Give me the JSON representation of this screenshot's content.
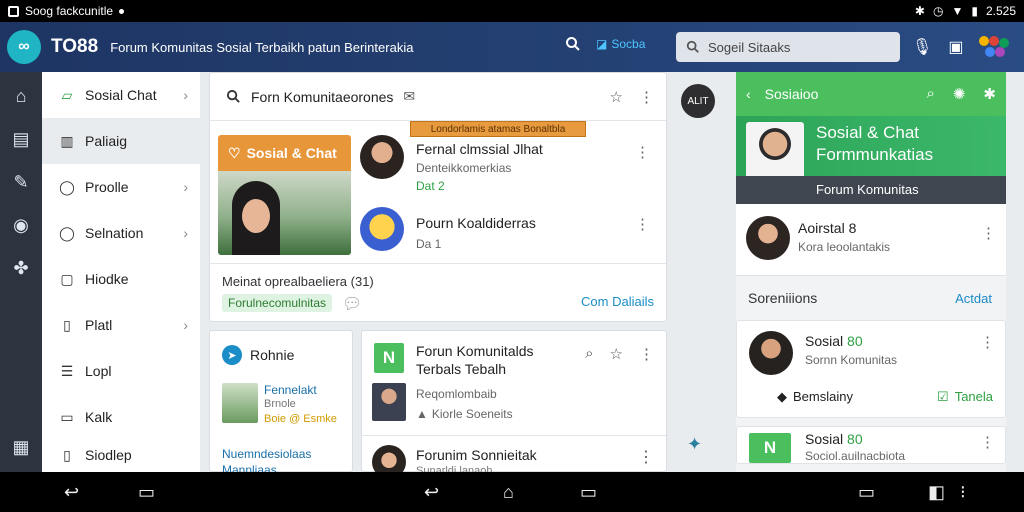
{
  "status": {
    "app_label": "Soog fackcunitle",
    "time": "2.525"
  },
  "appbar": {
    "logo_mark": "∞",
    "brand": "TO88",
    "tagline": "Forum Komunitas Sosial Terbaikh patun Berinterakia",
    "link": "Socba",
    "search_placeholder": "Sogeil Sitaaks"
  },
  "sidebar": {
    "items": [
      {
        "label": "Sosial Chat",
        "icon": "chat-icon",
        "chevron": true
      },
      {
        "label": "Paliaig",
        "icon": "book-icon",
        "chevron": false
      },
      {
        "label": "Proolle",
        "icon": "comment-icon",
        "chevron": true
      },
      {
        "label": "Selnation",
        "icon": "bubble-icon",
        "chevron": true
      },
      {
        "label": "Hiodke",
        "icon": "square-icon",
        "chevron": false
      },
      {
        "label": "Platl",
        "icon": "page-icon",
        "chevron": true
      },
      {
        "label": "Lopl",
        "icon": "list-icon",
        "chevron": false
      },
      {
        "label": "Kalk",
        "icon": "doc-icon",
        "chevron": false
      },
      {
        "label": "Siodlep",
        "icon": "file-icon",
        "chevron": false
      }
    ]
  },
  "main": {
    "search_title": "Forn Komunitaeorones",
    "banner": "Londorlamis atamas Bonaltbla",
    "feature_title": "Sosial & Chat",
    "feed": [
      {
        "title": "Fernal clmssial Jlhat",
        "sub": "Denteikkomerkias",
        "meta": "Dat 2"
      },
      {
        "title": "Pourn Koaldiderras",
        "sub": "Da 1",
        "meta": ""
      }
    ],
    "footer_title": "Meinat oprealbaeliera (31)",
    "footer_chip": "Forulnecomulnitas",
    "footer_link": "Com Daliails"
  },
  "card_small": {
    "title": "Rohnie",
    "person_name": "Fennelakt",
    "person_sub": "Brnole",
    "person_meta": "Boie @ Esmke",
    "footer": "Nuemndesiolaas",
    "footer2": "Mannliaas"
  },
  "card_mid": {
    "title": "Forun Komunitalds",
    "title2": "Terbals Tebalh",
    "sub": "Reqomlombaib",
    "meta": "Kiorle Soeneits",
    "title_b": "Forunim Sonnieitak",
    "sub_b": "Sunarldi lanaoh"
  },
  "gap": {
    "circle": "ALIT"
  },
  "right": {
    "header": "Sosiaioo",
    "hero_title": "Sosial & Chat",
    "hero_title2": "Formmunkatias",
    "hero_bar": "Forum Komunitas",
    "row1_title": "Aoirstal 8",
    "row1_sub": "Kora leoolantakis",
    "section": "Soreniiions",
    "section_link": "Actdat",
    "card1_title": "Sosial",
    "card1_badge": "80",
    "card1_sub": "Sornn Komunitas",
    "card1_action": "Bemslainy",
    "card1_link": "Tanela",
    "card2_title": "Sosial",
    "card2_badge": "80",
    "card2_sub": "Sociol.auilnacbiota"
  }
}
